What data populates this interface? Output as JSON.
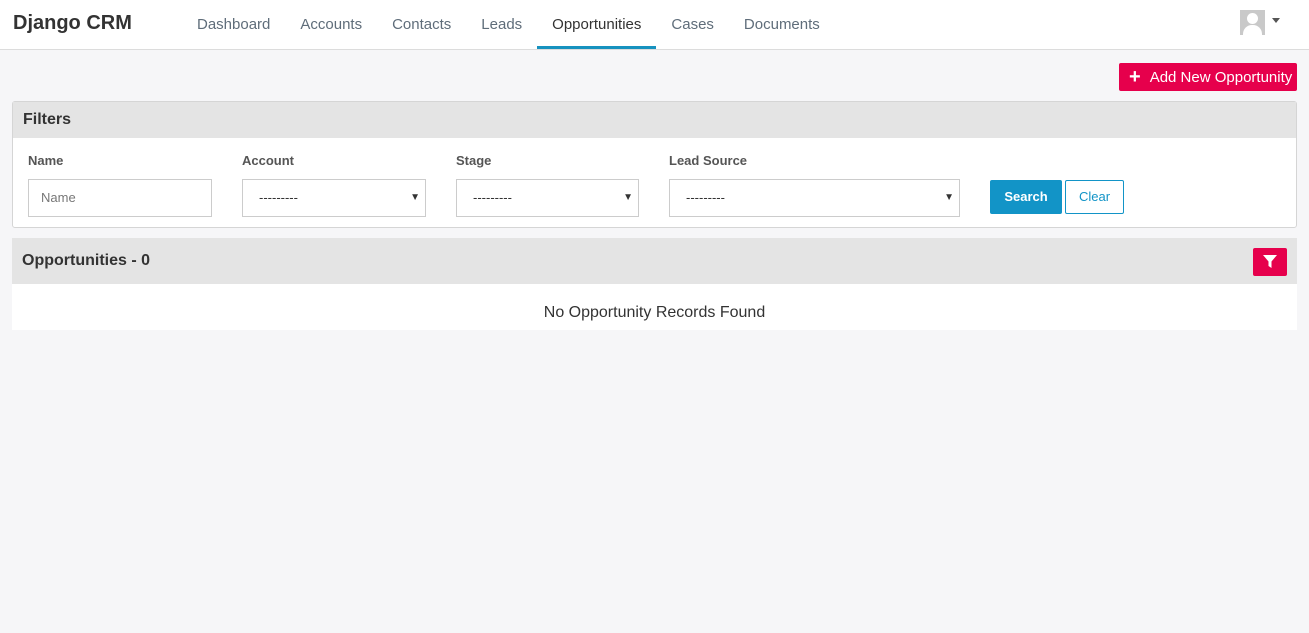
{
  "navbar": {
    "brand": "Django CRM",
    "items": [
      "Dashboard",
      "Accounts",
      "Contacts",
      "Leads",
      "Opportunities",
      "Cases",
      "Documents"
    ],
    "active": "Opportunities"
  },
  "actions": {
    "add_icon": "+",
    "add_label": "Add New Opportunity"
  },
  "filters": {
    "title": "Filters",
    "name_label": "Name",
    "name_placeholder": "Name",
    "account_label": "Account",
    "account_value": "---------",
    "stage_label": "Stage",
    "stage_value": "---------",
    "lead_source_label": "Lead Source",
    "lead_source_value": "---------",
    "search_label": "Search",
    "clear_label": "Clear"
  },
  "results": {
    "title": "Opportunities - 0",
    "empty_message": "No Opportunity Records Found"
  },
  "icons": {
    "avatar": "user-avatar-icon",
    "dropdown": "caret-down-icon",
    "filter": "filter-icon"
  },
  "colors": {
    "accent": "#e6004c",
    "primary": "#1294c7",
    "active_tab": "#1792bf"
  }
}
